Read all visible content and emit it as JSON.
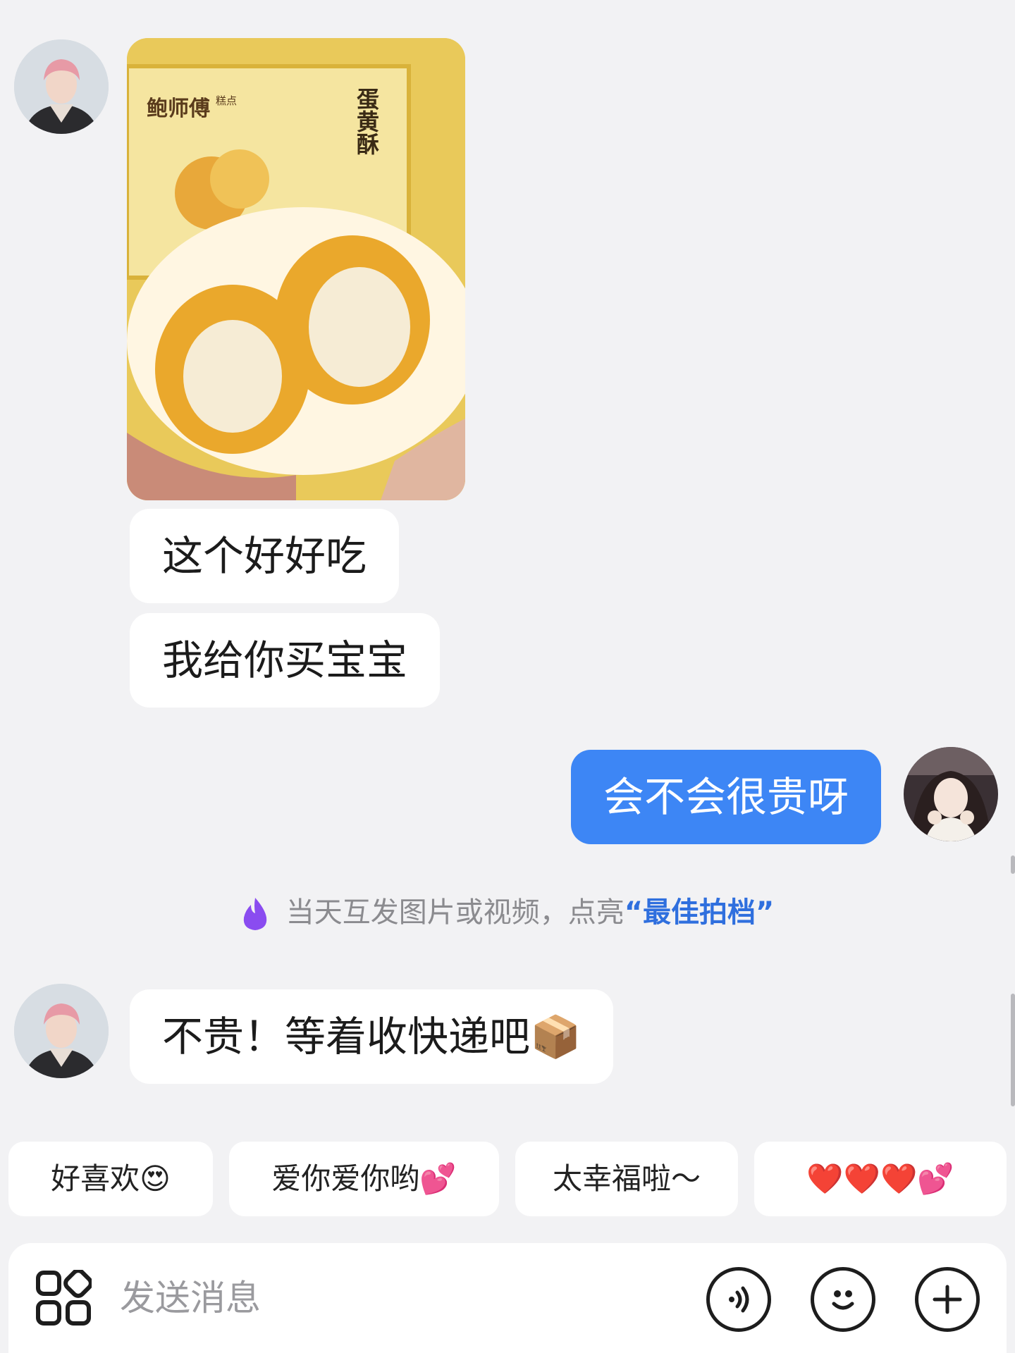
{
  "messages": {
    "m1": "这个好好吃",
    "m2": "我给你买宝宝",
    "m3": "会不会很贵呀",
    "m4": "不贵！等着收快递吧📦"
  },
  "photo": {
    "brand": "鲍师傅",
    "brand_sub": "糕点",
    "product": "蛋黄酥"
  },
  "notice": {
    "text": "当天互发图片或视频，点亮",
    "highlight": "“最佳拍档”"
  },
  "quick_replies": [
    "好喜欢😍",
    "爱你爱你哟💕",
    "太幸福啦～",
    "❤️❤️❤️💕"
  ],
  "input": {
    "placeholder": "发送消息"
  },
  "colors": {
    "background": "#f2f2f4",
    "my_bubble": "#3d86f5",
    "their_bubble": "#ffffff",
    "highlight": "#2f6fde"
  },
  "icons": [
    "apps-grid-icon",
    "voice-icon",
    "emoji-icon",
    "plus-icon",
    "flame-icon"
  ]
}
